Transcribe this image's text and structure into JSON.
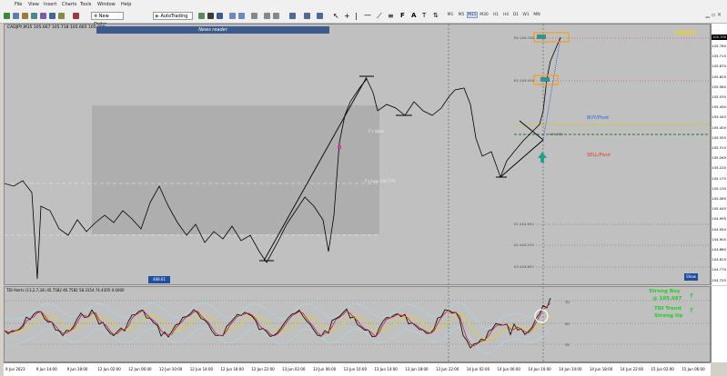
{
  "menu": [
    "File",
    "View",
    "Insert",
    "Charts",
    "Tools",
    "Window",
    "Help"
  ],
  "toolbar": {
    "new_order_label": "New Order",
    "autotrading_label": "AutoTrading",
    "timeframes": [
      "M1",
      "M5",
      "M15",
      "M30",
      "H1",
      "H4",
      "D1",
      "W1",
      "MN"
    ],
    "active_timeframe": "M15"
  },
  "chart": {
    "symbol_header": "CADJPY,M15  105.667 105.718 105.665 105.709",
    "news_reader": "News reader",
    "symbol_corner": "CADJPY",
    "buy_pivot": "BUY/Pivot",
    "sell_pivot": "SELL/Pivot",
    "fs_open": "F's Open",
    "fs_low": "F's Low: 104.774",
    "show_button": "Show",
    "left_tag": "488.61",
    "current_price_tag": "105.709",
    "price_labels": [
      "105.760",
      "105.715",
      "105.670",
      "105.625",
      "105.580",
      "105.535",
      "105.490",
      "105.445",
      "105.400",
      "105.355",
      "105.310",
      "105.265",
      "105.220",
      "105.175",
      "105.130",
      "105.085",
      "105.040",
      "104.995",
      "104.950",
      "104.905",
      "104.860",
      "104.815",
      "104.770",
      "104.725"
    ],
    "level_labels": {
      "r2": "R2 105.758",
      "r1": "R1 105.416",
      "pp": "105.080",
      "s1": "S1 104.591",
      "s2": "S2 104.233",
      "s3": "S3 103.897"
    }
  },
  "indicator": {
    "header": "TDI Alerts (13,2,7,34) 45.7582 46.7582 58.3154 74.4305 0.0000",
    "levels": [
      "70",
      "50",
      "32"
    ],
    "signal_strong_buy": "Strong Buy",
    "signal_price": "@ 105.687",
    "signal_trend": "TDI Trend",
    "signal_strong_up": "Strong Up"
  },
  "time_labels": [
    "9 Jun 2023",
    "9 Jun 14:00",
    "9 Jun 18:00",
    "12 Jun 02:00",
    "12 Jun 06:00",
    "12 Jun 10:00",
    "12 Jun 14:00",
    "12 Jun 18:00",
    "12 Jun 22:00",
    "13 Jun 02:00",
    "13 Jun 06:00",
    "13 Jun 10:00",
    "13 Jun 14:00",
    "13 Jun 18:00",
    "13 Jun 22:00",
    "14 Jun 02:00",
    "14 Jun 06:00",
    "14 Jun 10:00",
    "14 Jun 14:00",
    "14 Jun 18:00",
    "14 Jun 22:00",
    "15 Jun 02:00",
    "15 Jun 06:00"
  ],
  "colors": {
    "chart_bg": "#c0c0c0",
    "candle": "#000000",
    "buy_pivot": "#1a6bd6",
    "sell_pivot": "#e23b1e",
    "signal_green": "#22cc22",
    "orange_box": "#f0a020",
    "teal_arrow": "#20a090"
  }
}
